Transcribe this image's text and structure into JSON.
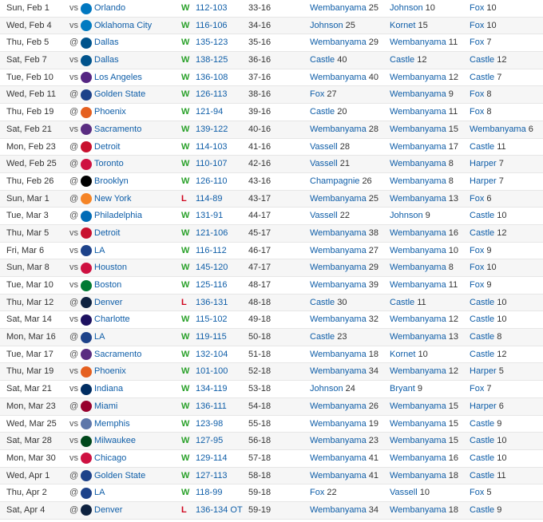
{
  "games": [
    {
      "date": "Sun, Feb 1",
      "loc": "vs",
      "opp": "Orlando",
      "logo_color": "#0077c0",
      "logo_icon": "orlando-magic-logo",
      "result": "W",
      "score": "112-103",
      "record": "33-16",
      "pts_name": "Wembanyama",
      "pts_val": "25",
      "reb_name": "Johnson",
      "reb_val": "10",
      "ast_name": "Fox",
      "ast_val": "10"
    },
    {
      "date": "Wed, Feb 4",
      "loc": "vs",
      "opp": "Oklahoma City",
      "logo_color": "#007ac1",
      "logo_icon": "okc-thunder-logo",
      "result": "W",
      "score": "116-106",
      "record": "34-16",
      "pts_name": "Johnson",
      "pts_val": "25",
      "reb_name": "Kornet",
      "reb_val": "15",
      "ast_name": "Fox",
      "ast_val": "10"
    },
    {
      "date": "Thu, Feb 5",
      "loc": "@",
      "opp": "Dallas",
      "logo_color": "#00538c",
      "logo_icon": "dallas-mavericks-logo",
      "result": "W",
      "score": "135-123",
      "record": "35-16",
      "pts_name": "Wembanyama",
      "pts_val": "29",
      "reb_name": "Wembanyama",
      "reb_val": "11",
      "ast_name": "Fox",
      "ast_val": "7"
    },
    {
      "date": "Sat, Feb 7",
      "loc": "vs",
      "opp": "Dallas",
      "logo_color": "#00538c",
      "logo_icon": "dallas-mavericks-logo",
      "result": "W",
      "score": "138-125",
      "record": "36-16",
      "pts_name": "Castle",
      "pts_val": "40",
      "reb_name": "Castle",
      "reb_val": "12",
      "ast_name": "Castle",
      "ast_val": "12"
    },
    {
      "date": "Tue, Feb 10",
      "loc": "vs",
      "opp": "Los Angeles",
      "logo_color": "#552583",
      "logo_icon": "la-lakers-logo",
      "result": "W",
      "score": "136-108",
      "record": "37-16",
      "pts_name": "Wembanyama",
      "pts_val": "40",
      "reb_name": "Wembanyama",
      "reb_val": "12",
      "ast_name": "Castle",
      "ast_val": "7"
    },
    {
      "date": "Wed, Feb 11",
      "loc": "@",
      "opp": "Golden State",
      "logo_color": "#1d428a",
      "logo_icon": "golden-state-warriors-logo",
      "result": "W",
      "score": "126-113",
      "record": "38-16",
      "pts_name": "Fox",
      "pts_val": "27",
      "reb_name": "Wembanyama",
      "reb_val": "9",
      "ast_name": "Fox",
      "ast_val": "8"
    },
    {
      "date": "Thu, Feb 19",
      "loc": "@",
      "opp": "Phoenix",
      "logo_color": "#e56020",
      "logo_icon": "phoenix-suns-logo",
      "result": "W",
      "score": "121-94",
      "record": "39-16",
      "pts_name": "Castle",
      "pts_val": "20",
      "reb_name": "Wembanyama",
      "reb_val": "11",
      "ast_name": "Fox",
      "ast_val": "8"
    },
    {
      "date": "Sat, Feb 21",
      "loc": "vs",
      "opp": "Sacramento",
      "logo_color": "#5a2d81",
      "logo_icon": "sacramento-kings-logo",
      "result": "W",
      "score": "139-122",
      "record": "40-16",
      "pts_name": "Wembanyama",
      "pts_val": "28",
      "reb_name": "Wembanyama",
      "reb_val": "15",
      "ast_name": "Wembanyama",
      "ast_val": "6"
    },
    {
      "date": "Mon, Feb 23",
      "loc": "@",
      "opp": "Detroit",
      "logo_color": "#c8102e",
      "logo_icon": "detroit-pistons-logo",
      "result": "W",
      "score": "114-103",
      "record": "41-16",
      "pts_name": "Vassell",
      "pts_val": "28",
      "reb_name": "Wembanyama",
      "reb_val": "17",
      "ast_name": "Castle",
      "ast_val": "11"
    },
    {
      "date": "Wed, Feb 25",
      "loc": "@",
      "opp": "Toronto",
      "logo_color": "#ce1141",
      "logo_icon": "toronto-raptors-logo",
      "result": "W",
      "score": "110-107",
      "record": "42-16",
      "pts_name": "Vassell",
      "pts_val": "21",
      "reb_name": "Wembanyama",
      "reb_val": "8",
      "ast_name": "Harper",
      "ast_val": "7"
    },
    {
      "date": "Thu, Feb 26",
      "loc": "@",
      "opp": "Brooklyn",
      "logo_color": "#000000",
      "logo_icon": "brooklyn-nets-logo",
      "result": "W",
      "score": "126-110",
      "record": "43-16",
      "pts_name": "Champagnie",
      "pts_val": "26",
      "reb_name": "Wembanyama",
      "reb_val": "8",
      "ast_name": "Harper",
      "ast_val": "7"
    },
    {
      "date": "Sun, Mar 1",
      "loc": "@",
      "opp": "New York",
      "logo_color": "#f58426",
      "logo_icon": "new-york-knicks-logo",
      "result": "L",
      "score": "114-89",
      "record": "43-17",
      "pts_name": "Wembanyama",
      "pts_val": "25",
      "reb_name": "Wembanyama",
      "reb_val": "13",
      "ast_name": "Fox",
      "ast_val": "6"
    },
    {
      "date": "Tue, Mar 3",
      "loc": "@",
      "opp": "Philadelphia",
      "logo_color": "#006bb6",
      "logo_icon": "philadelphia-76ers-logo",
      "result": "W",
      "score": "131-91",
      "record": "44-17",
      "pts_name": "Vassell",
      "pts_val": "22",
      "reb_name": "Johnson",
      "reb_val": "9",
      "ast_name": "Castle",
      "ast_val": "10"
    },
    {
      "date": "Thu, Mar 5",
      "loc": "vs",
      "opp": "Detroit",
      "logo_color": "#c8102e",
      "logo_icon": "detroit-pistons-logo",
      "result": "W",
      "score": "121-106",
      "record": "45-17",
      "pts_name": "Wembanyama",
      "pts_val": "38",
      "reb_name": "Wembanyama",
      "reb_val": "16",
      "ast_name": "Castle",
      "ast_val": "12"
    },
    {
      "date": "Fri, Mar 6",
      "loc": "vs",
      "opp": "LA",
      "logo_color": "#1d428a",
      "logo_icon": "la-clippers-logo",
      "result": "W",
      "score": "116-112",
      "record": "46-17",
      "pts_name": "Wembanyama",
      "pts_val": "27",
      "reb_name": "Wembanyama",
      "reb_val": "10",
      "ast_name": "Fox",
      "ast_val": "9"
    },
    {
      "date": "Sun, Mar 8",
      "loc": "vs",
      "opp": "Houston",
      "logo_color": "#ce1141",
      "logo_icon": "houston-rockets-logo",
      "result": "W",
      "score": "145-120",
      "record": "47-17",
      "pts_name": "Wembanyama",
      "pts_val": "29",
      "reb_name": "Wembanyama",
      "reb_val": "8",
      "ast_name": "Fox",
      "ast_val": "10"
    },
    {
      "date": "Tue, Mar 10",
      "loc": "vs",
      "opp": "Boston",
      "logo_color": "#007a33",
      "logo_icon": "boston-celtics-logo",
      "result": "W",
      "score": "125-116",
      "record": "48-17",
      "pts_name": "Wembanyama",
      "pts_val": "39",
      "reb_name": "Wembanyama",
      "reb_val": "11",
      "ast_name": "Fox",
      "ast_val": "9"
    },
    {
      "date": "Thu, Mar 12",
      "loc": "@",
      "opp": "Denver",
      "logo_color": "#0e2240",
      "logo_icon": "denver-nuggets-logo",
      "result": "L",
      "score": "136-131",
      "record": "48-18",
      "pts_name": "Castle",
      "pts_val": "30",
      "reb_name": "Castle",
      "reb_val": "11",
      "ast_name": "Castle",
      "ast_val": "10"
    },
    {
      "date": "Sat, Mar 14",
      "loc": "vs",
      "opp": "Charlotte",
      "logo_color": "#1d1160",
      "logo_icon": "charlotte-hornets-logo",
      "result": "W",
      "score": "115-102",
      "record": "49-18",
      "pts_name": "Wembanyama",
      "pts_val": "32",
      "reb_name": "Wembanyama",
      "reb_val": "12",
      "ast_name": "Castle",
      "ast_val": "10"
    },
    {
      "date": "Mon, Mar 16",
      "loc": "@",
      "opp": "LA",
      "logo_color": "#1d428a",
      "logo_icon": "la-clippers-logo",
      "result": "W",
      "score": "119-115",
      "record": "50-18",
      "pts_name": "Castle",
      "pts_val": "23",
      "reb_name": "Wembanyama",
      "reb_val": "13",
      "ast_name": "Castle",
      "ast_val": "8"
    },
    {
      "date": "Tue, Mar 17",
      "loc": "@",
      "opp": "Sacramento",
      "logo_color": "#5a2d81",
      "logo_icon": "sacramento-kings-logo",
      "result": "W",
      "score": "132-104",
      "record": "51-18",
      "pts_name": "Wembanyama",
      "pts_val": "18",
      "reb_name": "Kornet",
      "reb_val": "10",
      "ast_name": "Castle",
      "ast_val": "12"
    },
    {
      "date": "Thu, Mar 19",
      "loc": "vs",
      "opp": "Phoenix",
      "logo_color": "#e56020",
      "logo_icon": "phoenix-suns-logo",
      "result": "W",
      "score": "101-100",
      "record": "52-18",
      "pts_name": "Wembanyama",
      "pts_val": "34",
      "reb_name": "Wembanyama",
      "reb_val": "12",
      "ast_name": "Harper",
      "ast_val": "5"
    },
    {
      "date": "Sat, Mar 21",
      "loc": "vs",
      "opp": "Indiana",
      "logo_color": "#002d62",
      "logo_icon": "indiana-pacers-logo",
      "result": "W",
      "score": "134-119",
      "record": "53-18",
      "pts_name": "Johnson",
      "pts_val": "24",
      "reb_name": "Bryant",
      "reb_val": "9",
      "ast_name": "Fox",
      "ast_val": "7"
    },
    {
      "date": "Mon, Mar 23",
      "loc": "@",
      "opp": "Miami",
      "logo_color": "#98002e",
      "logo_icon": "miami-heat-logo",
      "result": "W",
      "score": "136-111",
      "record": "54-18",
      "pts_name": "Wembanyama",
      "pts_val": "26",
      "reb_name": "Wembanyama",
      "reb_val": "15",
      "ast_name": "Harper",
      "ast_val": "6"
    },
    {
      "date": "Wed, Mar 25",
      "loc": "vs",
      "opp": "Memphis",
      "logo_color": "#5d76a9",
      "logo_icon": "memphis-grizzlies-logo",
      "result": "W",
      "score": "123-98",
      "record": "55-18",
      "pts_name": "Wembanyama",
      "pts_val": "19",
      "reb_name": "Wembanyama",
      "reb_val": "15",
      "ast_name": "Castle",
      "ast_val": "9"
    },
    {
      "date": "Sat, Mar 28",
      "loc": "vs",
      "opp": "Milwaukee",
      "logo_color": "#00471b",
      "logo_icon": "milwaukee-bucks-logo",
      "result": "W",
      "score": "127-95",
      "record": "56-18",
      "pts_name": "Wembanyama",
      "pts_val": "23",
      "reb_name": "Wembanyama",
      "reb_val": "15",
      "ast_name": "Castle",
      "ast_val": "10"
    },
    {
      "date": "Mon, Mar 30",
      "loc": "vs",
      "opp": "Chicago",
      "logo_color": "#ce1141",
      "logo_icon": "chicago-bulls-logo",
      "result": "W",
      "score": "129-114",
      "record": "57-18",
      "pts_name": "Wembanyama",
      "pts_val": "41",
      "reb_name": "Wembanyama",
      "reb_val": "16",
      "ast_name": "Castle",
      "ast_val": "10"
    },
    {
      "date": "Wed, Apr 1",
      "loc": "@",
      "opp": "Golden State",
      "logo_color": "#1d428a",
      "logo_icon": "golden-state-warriors-logo",
      "result": "W",
      "score": "127-113",
      "record": "58-18",
      "pts_name": "Wembanyama",
      "pts_val": "41",
      "reb_name": "Wembanyama",
      "reb_val": "18",
      "ast_name": "Castle",
      "ast_val": "11"
    },
    {
      "date": "Thu, Apr 2",
      "loc": "@",
      "opp": "LA",
      "logo_color": "#1d428a",
      "logo_icon": "la-clippers-logo",
      "result": "W",
      "score": "118-99",
      "record": "59-18",
      "pts_name": "Fox",
      "pts_val": "22",
      "reb_name": "Vassell",
      "reb_val": "10",
      "ast_name": "Fox",
      "ast_val": "5"
    },
    {
      "date": "Sat, Apr 4",
      "loc": "@",
      "opp": "Denver",
      "logo_color": "#0e2240",
      "logo_icon": "denver-nuggets-logo",
      "result": "L",
      "score": "136-134 OT",
      "record": "59-19",
      "pts_name": "Wembanyama",
      "pts_val": "34",
      "reb_name": "Wembanyama",
      "reb_val": "18",
      "ast_name": "Castle",
      "ast_val": "9"
    }
  ],
  "colors": {
    "link": "#0f5ea8",
    "win": "#2aa12a",
    "loss": "#d0021b",
    "row_alt": "#f6f6f6",
    "border": "#e6e6e6"
  }
}
